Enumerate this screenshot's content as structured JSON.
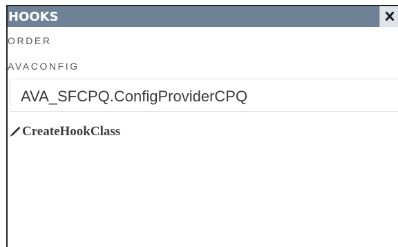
{
  "panel": {
    "title": "HOOKS",
    "close_icon": "close-icon"
  },
  "fields": {
    "order_label": "ORDER",
    "avaconfig_label": "AVACONFIG",
    "avaconfig_value": "AVA_SFCPQ.ConfigProviderCPQ"
  },
  "actions": {
    "create_hook_icon": "pencil-icon",
    "create_hook_label": "CreateHookClass"
  },
  "colors": {
    "header_bg": "#6f8197",
    "header_text": "#ffffff",
    "close_bg": "#dfe4ea",
    "label_text": "#555555",
    "link_text": "#3c3c3c"
  }
}
